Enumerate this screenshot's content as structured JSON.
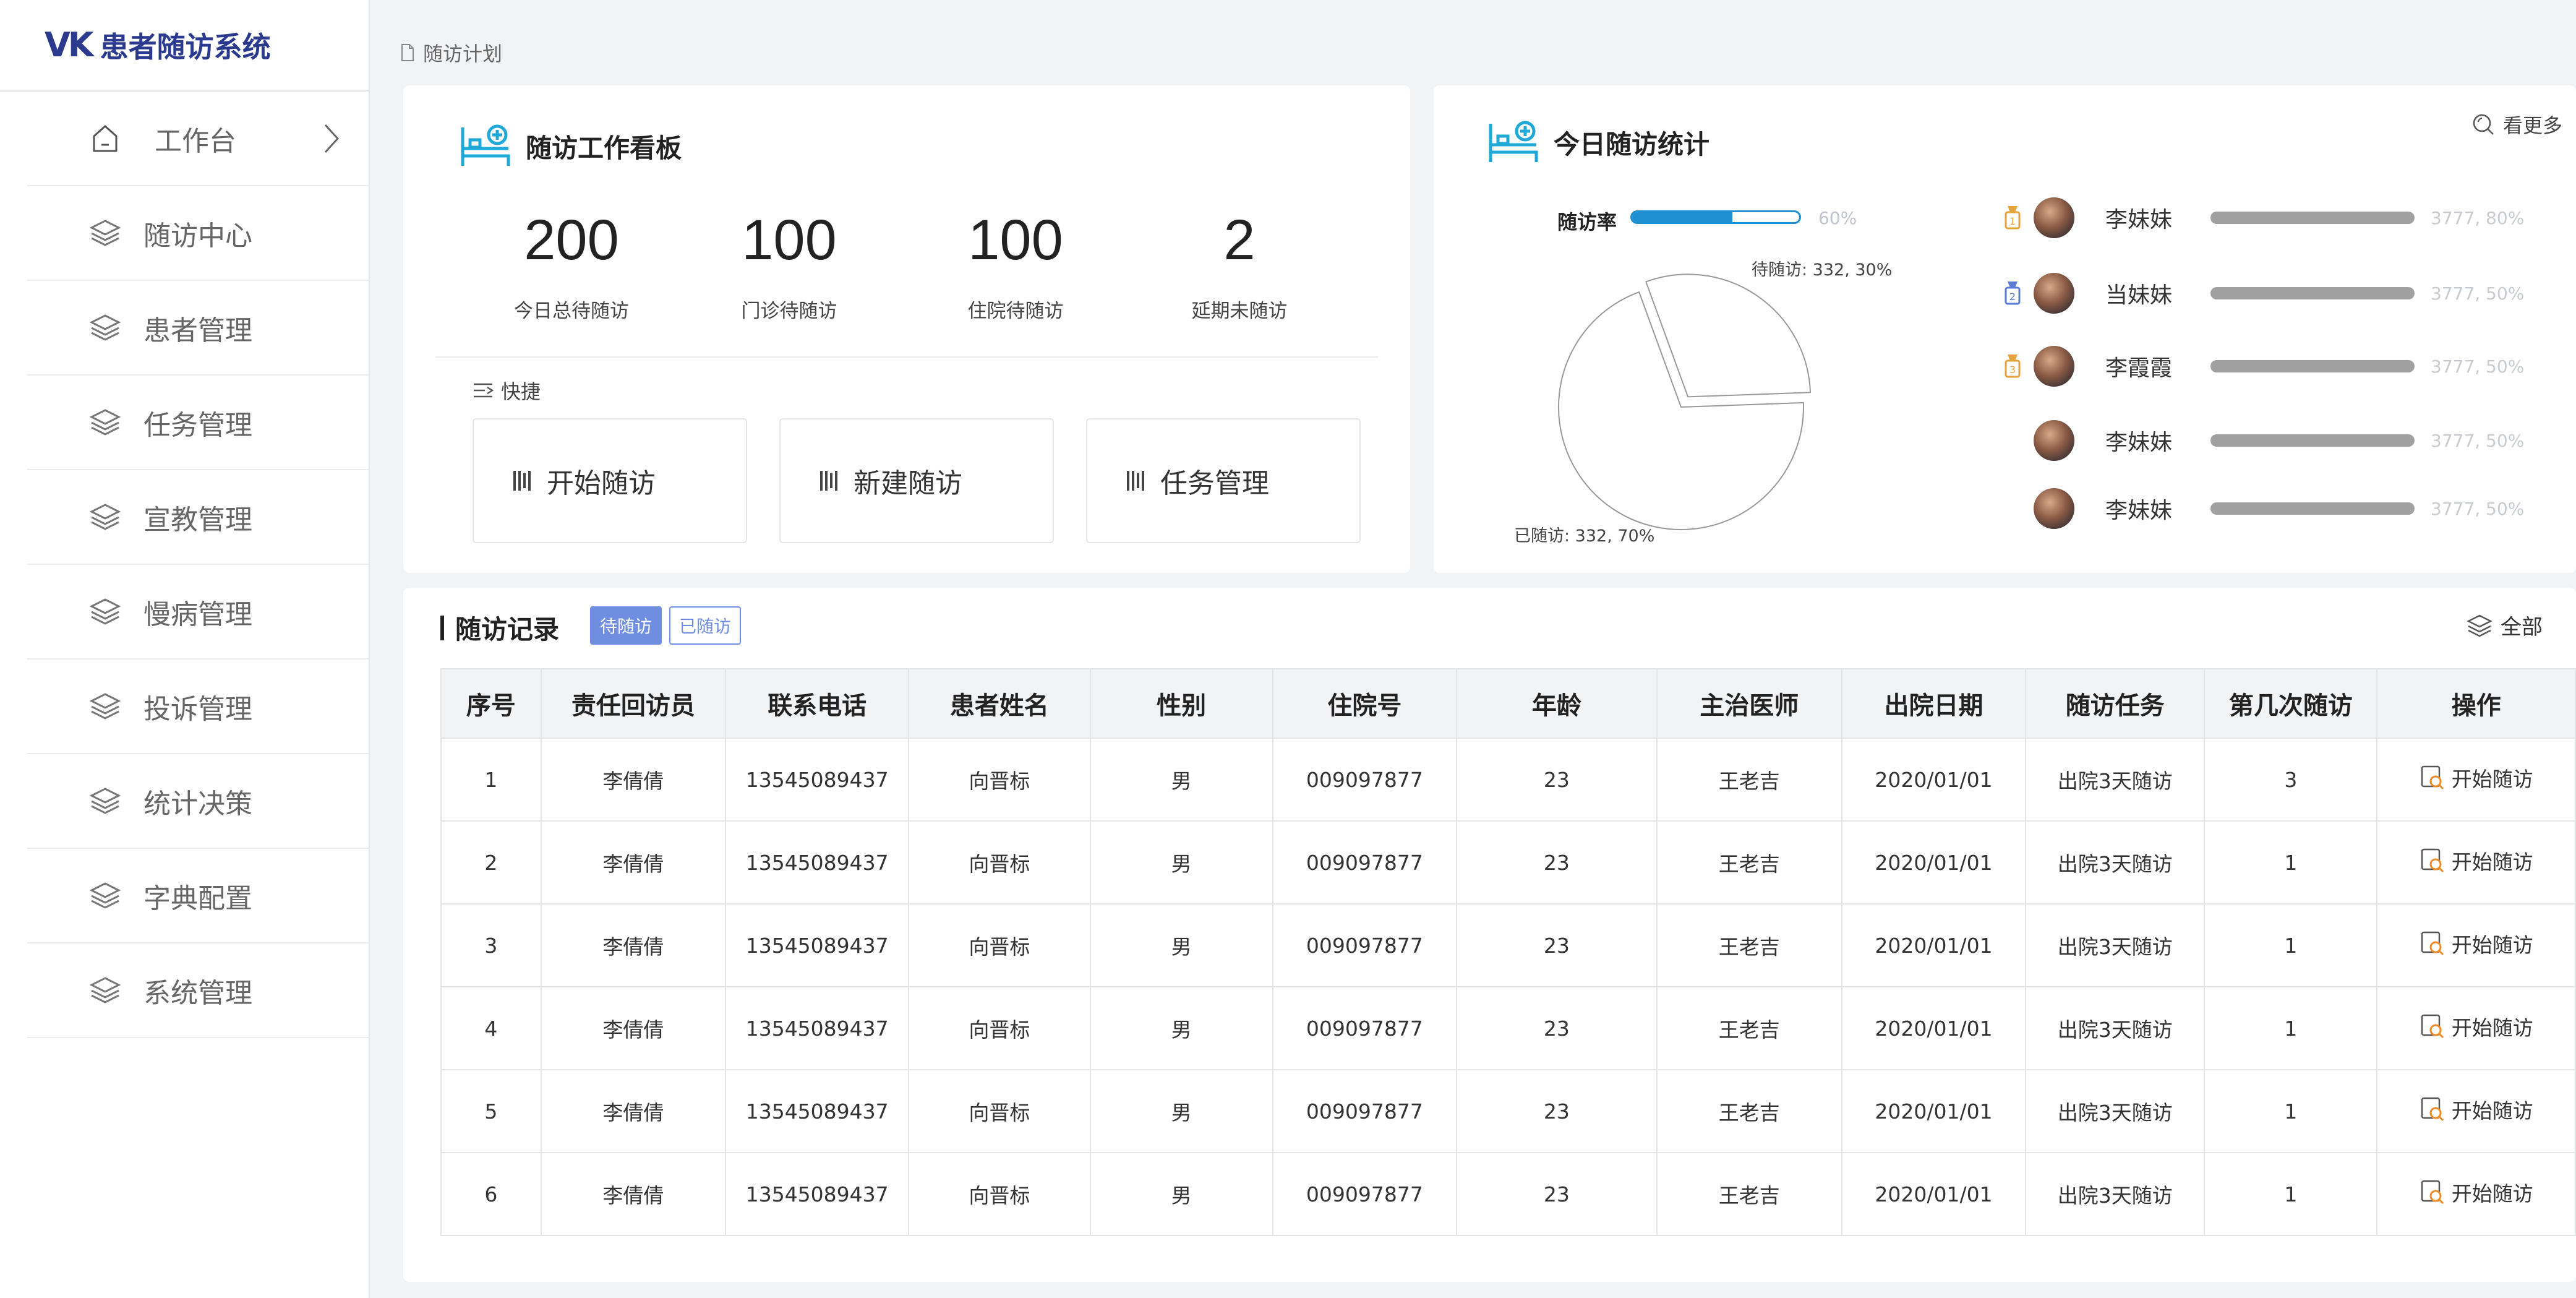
{
  "app": {
    "logo_mark": "VK",
    "title": "患者随访系统"
  },
  "sidebar": {
    "items": [
      {
        "label": "工作台",
        "icon": "home-icon"
      },
      {
        "label": "随访中心",
        "icon": "layers-icon"
      },
      {
        "label": "患者管理",
        "icon": "layers-icon"
      },
      {
        "label": "任务管理",
        "icon": "layers-icon"
      },
      {
        "label": "宣教管理",
        "icon": "layers-icon"
      },
      {
        "label": "慢病管理",
        "icon": "layers-icon"
      },
      {
        "label": "投诉管理",
        "icon": "layers-icon"
      },
      {
        "label": "统计决策",
        "icon": "layers-icon"
      },
      {
        "label": "字典配置",
        "icon": "layers-icon"
      },
      {
        "label": "系统管理",
        "icon": "layers-icon"
      }
    ]
  },
  "breadcrumb": "随访计划",
  "kanban": {
    "title": "随访工作看板",
    "stats": [
      {
        "value": "200",
        "label": "今日总待随访"
      },
      {
        "value": "100",
        "label": "门诊待随访"
      },
      {
        "value": "100",
        "label": "住院待随访"
      },
      {
        "value": "2",
        "label": "延期未随访"
      }
    ],
    "quick_label": "快捷",
    "quick_buttons": [
      "开始随访",
      "新建随访",
      "任务管理"
    ]
  },
  "today": {
    "title": "今日随访统计",
    "more_label": "看更多",
    "rate_label": "随访率",
    "rate_value": "60%",
    "rate_fraction": 0.6,
    "pie": {
      "pending_label": "待随访: 332, 30%",
      "done_label": "已随访: 332, 70%",
      "pending_fraction": 0.3
    },
    "ranking": [
      {
        "name": "李妹妹",
        "value": "3777, 80%",
        "medal": "1"
      },
      {
        "name": "当妹妹",
        "value": "3777, 50%",
        "medal": "2"
      },
      {
        "name": "李霞霞",
        "value": "3777, 50%",
        "medal": "3"
      },
      {
        "name": "李妹妹",
        "value": "3777, 50%",
        "medal": ""
      },
      {
        "name": "李妹妹",
        "value": "3777, 50%",
        "medal": ""
      }
    ],
    "colors": {
      "accent": "#1e8fd1",
      "medal_gold": "#e6a23c",
      "medal_silver": "#5b7bd5"
    }
  },
  "records": {
    "title": "随访记录",
    "tabs": [
      "待随访",
      "已随访"
    ],
    "all_label": "全部",
    "columns": [
      "序号",
      "责任回访员",
      "联系电话",
      "患者姓名",
      "性别",
      "住院号",
      "年龄",
      "主治医师",
      "出院日期",
      "随访任务",
      "第几次随访",
      "操作"
    ],
    "action_label": "开始随访",
    "rows": [
      [
        "1",
        "李倩倩",
        "13545089437",
        "向晋标",
        "男",
        "009097877",
        "23",
        "王老吉",
        "2020/01/01",
        "出院3天随访",
        "3"
      ],
      [
        "2",
        "李倩倩",
        "13545089437",
        "向晋标",
        "男",
        "009097877",
        "23",
        "王老吉",
        "2020/01/01",
        "出院3天随访",
        "1"
      ],
      [
        "3",
        "李倩倩",
        "13545089437",
        "向晋标",
        "男",
        "009097877",
        "23",
        "王老吉",
        "2020/01/01",
        "出院3天随访",
        "1"
      ],
      [
        "4",
        "李倩倩",
        "13545089437",
        "向晋标",
        "男",
        "009097877",
        "23",
        "王老吉",
        "2020/01/01",
        "出院3天随访",
        "1"
      ],
      [
        "5",
        "李倩倩",
        "13545089437",
        "向晋标",
        "男",
        "009097877",
        "23",
        "王老吉",
        "2020/01/01",
        "出院3天随访",
        "1"
      ],
      [
        "6",
        "李倩倩",
        "13545089437",
        "向晋标",
        "男",
        "009097877",
        "23",
        "王老吉",
        "2020/01/01",
        "出院3天随访",
        "1"
      ]
    ]
  }
}
